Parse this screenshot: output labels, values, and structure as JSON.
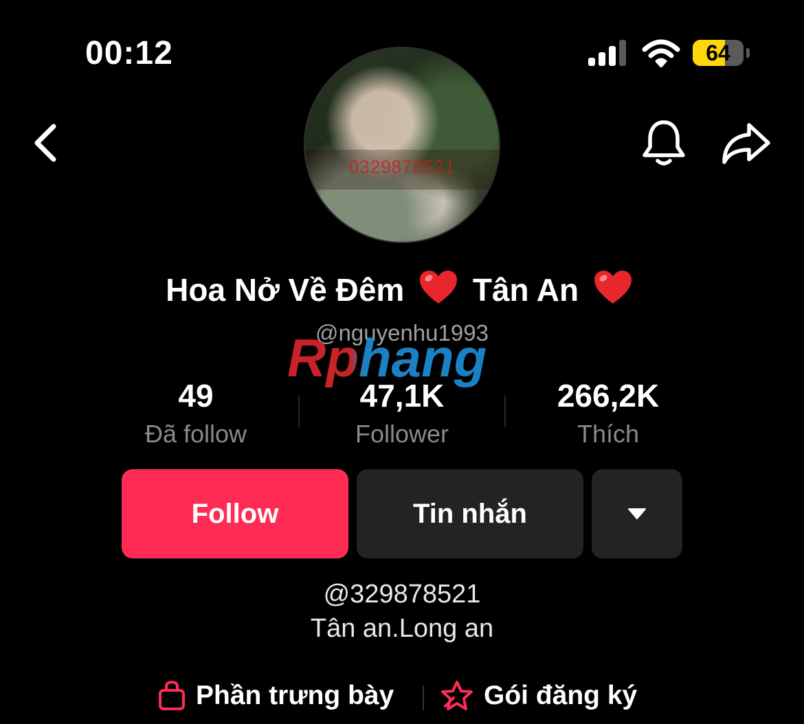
{
  "status_bar": {
    "time": "00:12",
    "battery": "64",
    "battery_level": 0.64
  },
  "profile": {
    "display_name": "Hoa Nở Về Đêm",
    "display_name_suffix": "Tân An",
    "username": "@nguyenhu1993",
    "avatar_overlay_text": "0329878521",
    "watermark": "Rphang"
  },
  "stats": [
    {
      "value": "49",
      "label": "Đã follow"
    },
    {
      "value": "47,1K",
      "label": "Follower"
    },
    {
      "value": "266,2K",
      "label": "Thích"
    }
  ],
  "actions": {
    "follow": "Follow",
    "message": "Tin nhắn"
  },
  "bio": {
    "line1": "@329878521",
    "line2": "Tân an.Long an"
  },
  "bottom_links": {
    "showcase": "Phần trưng bày",
    "subscription": "Gói đăng ký"
  },
  "colors": {
    "accent": "#fe2c55",
    "secondary_button": "#232323",
    "battery": "#ffd60a",
    "muted_text": "#8a8a8a"
  },
  "icons": {
    "back": "chevron-left-icon",
    "notification": "bell-icon",
    "share": "share-arrow-icon",
    "more": "caret-down-icon",
    "showcase": "shopping-bag-icon",
    "subscription": "star-badge-icon"
  }
}
